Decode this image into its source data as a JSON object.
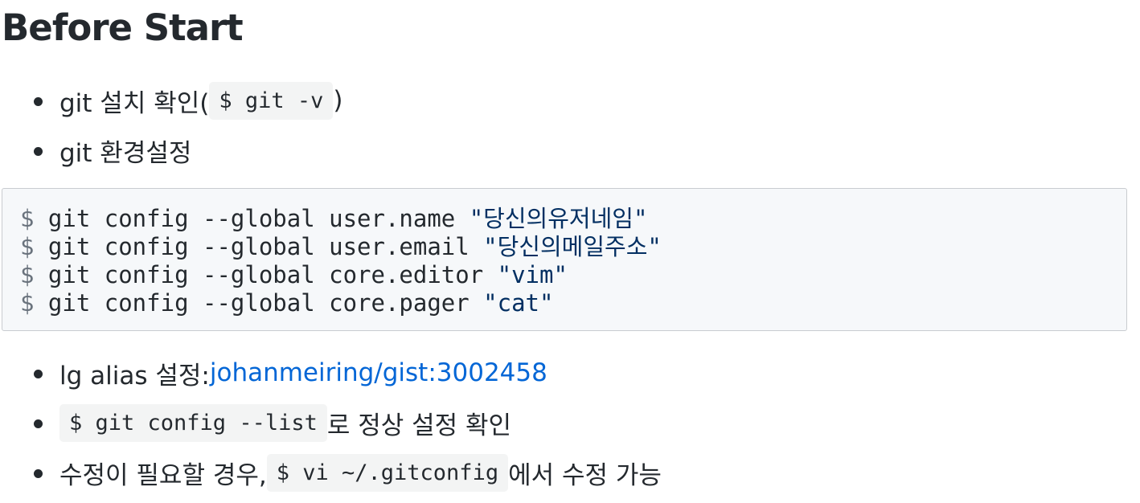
{
  "heading": "Before Start",
  "list_top": [
    {
      "text": "git 설치 확인(",
      "code": "$ git -v",
      "after": ")"
    },
    {
      "text": "git 환경설정"
    }
  ],
  "code_block": {
    "lines": [
      {
        "prompt": "$",
        "command": " git config --global user.name ",
        "string": "\"당신의유저네임\""
      },
      {
        "prompt": "$",
        "command": " git config --global user.email ",
        "string": "\"당신의메일주소\""
      },
      {
        "prompt": "$",
        "command": " git config --global core.editor ",
        "string": "\"vim\""
      },
      {
        "prompt": "$",
        "command": " git config --global core.pager ",
        "string": "\"cat\""
      }
    ]
  },
  "list_bottom": [
    {
      "text": "lg alias 설정: ",
      "link": "johanmeiring/gist:3002458"
    },
    {
      "code": "$ git config --list",
      "after": " 로 정상 설정 확인"
    },
    {
      "text": "수정이 필요할 경우, ",
      "code": "$ vi ~/.gitconfig",
      "after": " 에서 수정 가능"
    }
  ],
  "colors": {
    "text": "#24292e",
    "link": "#0366d6",
    "code_bg": "#f6f8fa",
    "inline_code_bg": "#f3f4f4",
    "prompt": "#6a737d",
    "string": "#032f62"
  },
  "icons": {
    "bullet": "bullet-dot-icon"
  }
}
